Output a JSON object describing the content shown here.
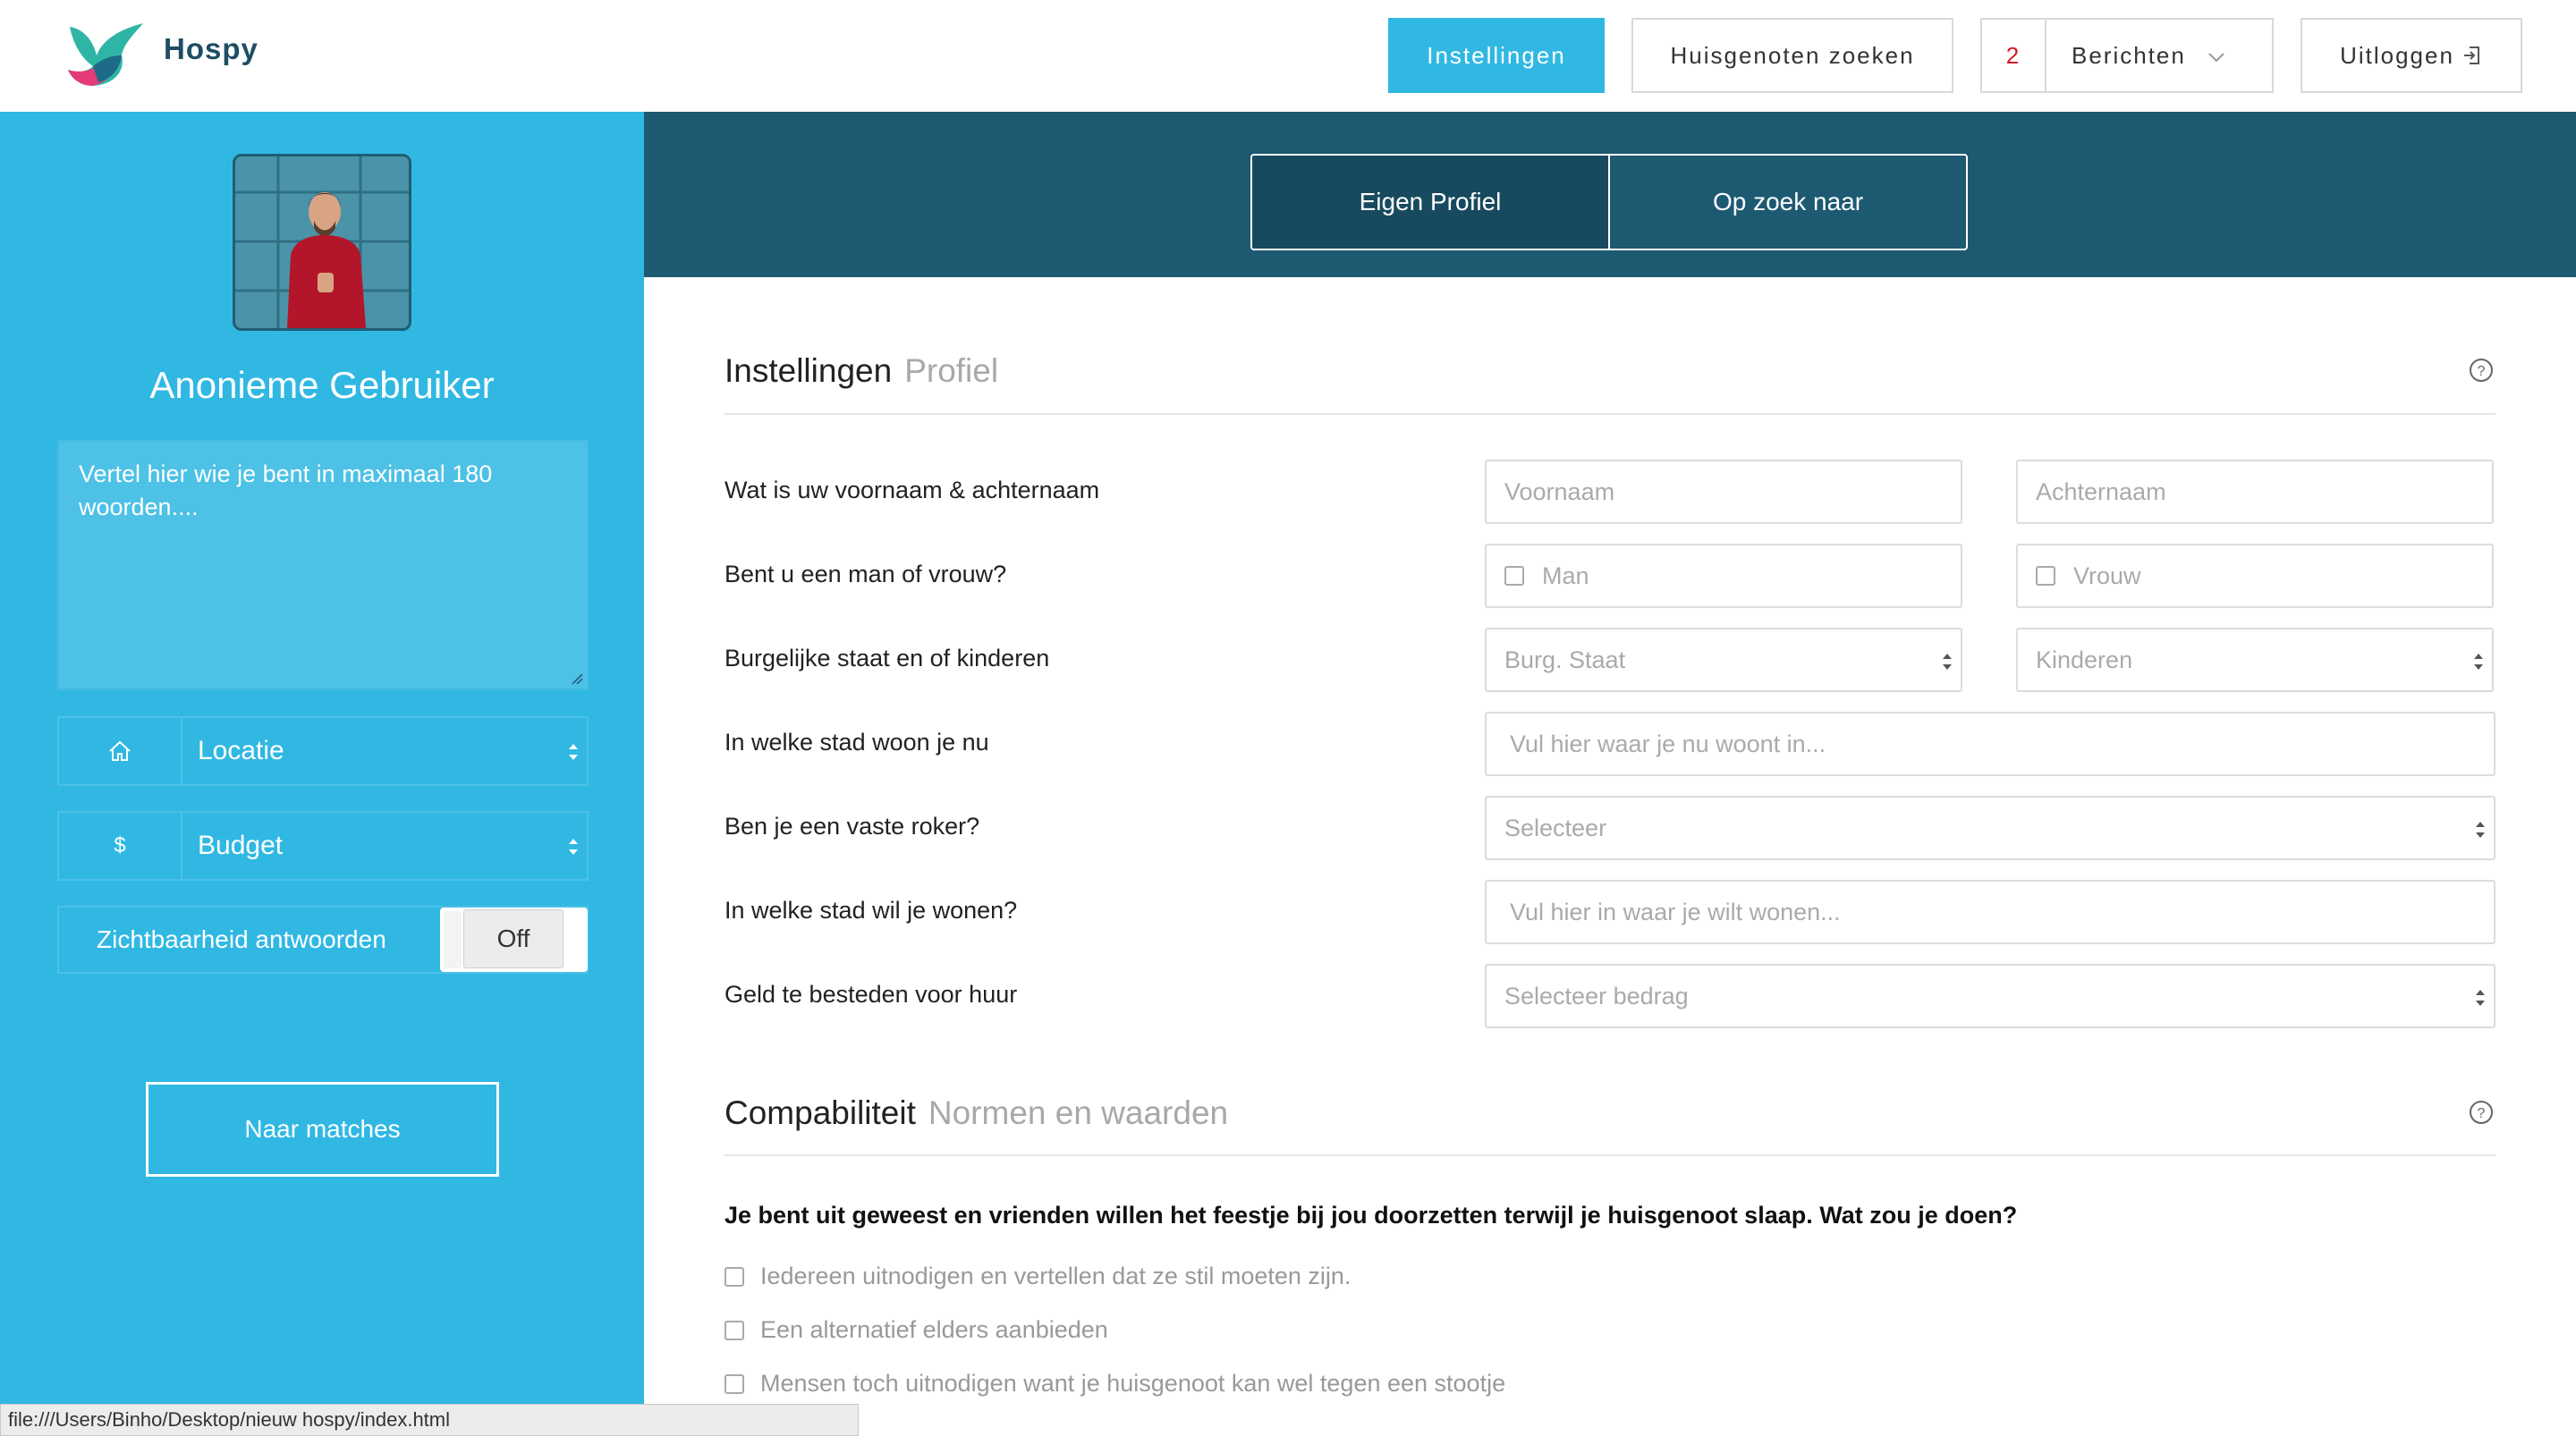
{
  "app": {
    "name": "Hospy",
    "brand_color": "#30b8e3",
    "dark_color": "#1d5a72"
  },
  "nav": {
    "settings": "Instellingen",
    "find_roommates": "Huisgenoten zoeken",
    "messages_count": "2",
    "messages": "Berichten",
    "logout": "Uitloggen"
  },
  "sidebar": {
    "user_name": "Anonieme Gebruiker",
    "bio_placeholder": "Vertel hier wie je bent in maximaal 180 woorden....",
    "location_label": "Locatie",
    "budget_icon": "$",
    "budget_label": "Budget",
    "visibility_label": "Zichtbaarheid antwoorden",
    "visibility_state": "Off",
    "matches_button": "Naar matches"
  },
  "tabs": [
    {
      "label": "Eigen Profiel",
      "active": true
    },
    {
      "label": "Op zoek naar",
      "active": false
    }
  ],
  "settings": {
    "title": "Instellingen",
    "subtitle": "Profiel",
    "rows": [
      {
        "question": "Wat is uw voornaam & achternaam",
        "fields": [
          "Voornaam",
          "Achternaam"
        ]
      },
      {
        "question": "Bent u een man of vrouw?",
        "fields": [
          "Man",
          "Vrouw"
        ]
      },
      {
        "question": "Burgelijke staat en of kinderen",
        "fields": [
          "Burg. Staat",
          "Kinderen"
        ]
      },
      {
        "question": "In welke stad woon je nu",
        "fields": [
          "Vul hier waar je nu woont in..."
        ]
      },
      {
        "question": "Ben je een vaste roker?",
        "fields": [
          "Selecteer"
        ]
      },
      {
        "question": "In welke stad wil je wonen?",
        "fields": [
          "Vul hier in waar je wilt wonen..."
        ]
      },
      {
        "question": "Geld te besteden voor huur",
        "fields": [
          "Selecteer bedrag"
        ]
      }
    ]
  },
  "compatibility": {
    "title": "Compabiliteit",
    "subtitle": "Normen en waarden",
    "question": "Je bent uit geweest en vrienden willen het feestje bij jou doorzetten terwijl je huisgenoot slaap. Wat zou je doen?",
    "options": [
      "Iedereen uitnodigen en vertellen dat ze stil moeten zijn.",
      "Een alternatief elders aanbieden",
      "Mensen toch uitnodigen want je huisgenoot kan wel tegen een stootje"
    ]
  },
  "statusbar": {
    "url": "file:///Users/Binho/Desktop/nieuw hospy/index.html"
  }
}
